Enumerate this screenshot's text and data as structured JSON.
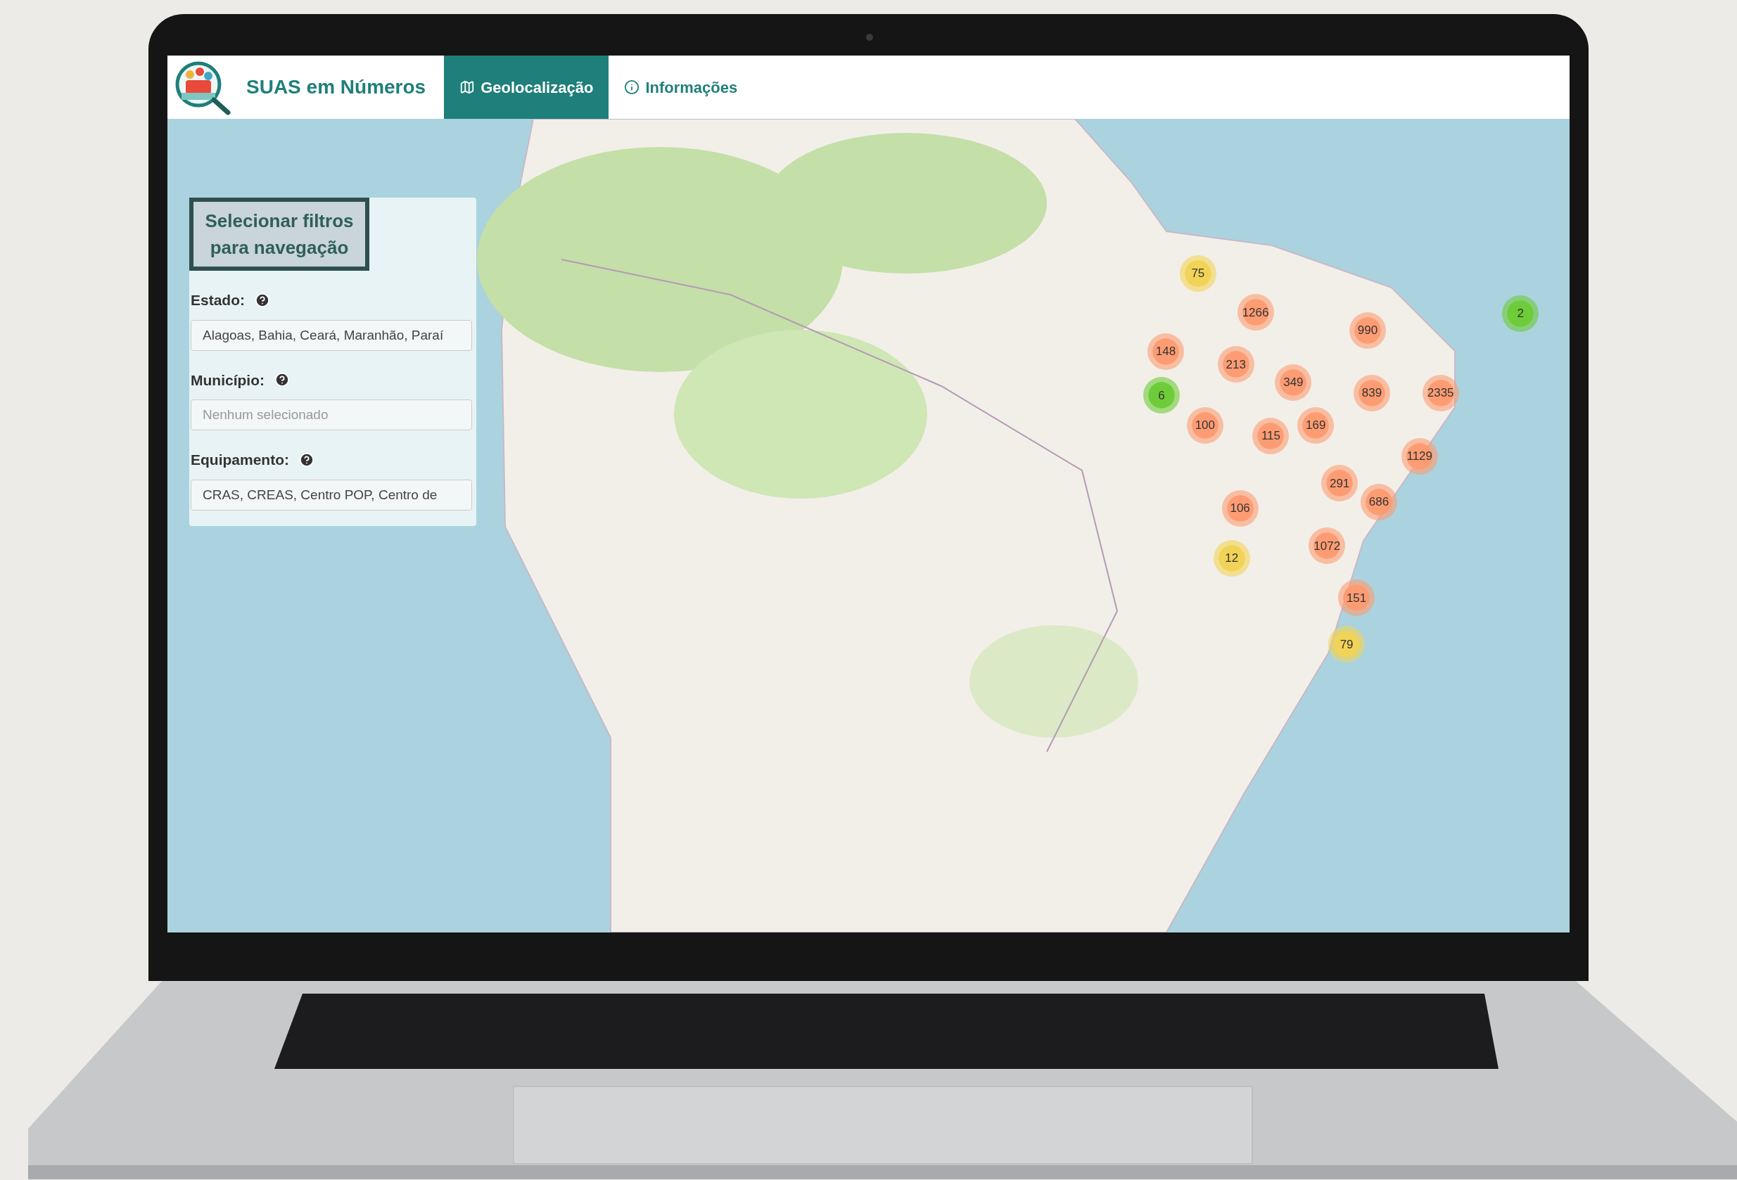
{
  "app": {
    "title": "SUAS em Números"
  },
  "nav": [
    {
      "label": "Geolocalização",
      "kind": "map",
      "selected": true
    },
    {
      "label": "Informações",
      "kind": "info",
      "selected": false
    }
  ],
  "filters": {
    "title": "Selecionar filtros para navegação",
    "fields": [
      {
        "label": "Estado:",
        "value": "Alagoas, Bahia, Ceará, Maranhão, Paraí"
      },
      {
        "label": "Município:",
        "placeholder": "Nenhum selecionado"
      },
      {
        "label": "Equipamento:",
        "value": "CRAS, CREAS, Centro POP, Centro de"
      }
    ]
  },
  "clusters": [
    {
      "count": "75",
      "color": "#f1d357"
    },
    {
      "count": "1266",
      "color": "#fd9c73"
    },
    {
      "count": "990",
      "color": "#fd9c73"
    },
    {
      "count": "2",
      "color": "#6ecc39"
    },
    {
      "count": "148",
      "color": "#fd9c73"
    },
    {
      "count": "213",
      "color": "#fd9c73"
    },
    {
      "count": "349",
      "color": "#fd9c73"
    },
    {
      "count": "6",
      "color": "#6ecc39"
    },
    {
      "count": "839",
      "color": "#fd9c73"
    },
    {
      "count": "2335",
      "color": "#fd9c73"
    },
    {
      "count": "100",
      "color": "#fd9c73"
    },
    {
      "count": "115",
      "color": "#fd9c73"
    },
    {
      "count": "169",
      "color": "#fd9c73"
    },
    {
      "count": "1129",
      "color": "#fd9c73"
    },
    {
      "count": "291",
      "color": "#fd9c73"
    },
    {
      "count": "686",
      "color": "#fd9c73"
    },
    {
      "count": "106",
      "color": "#fd9c73"
    },
    {
      "count": "1072",
      "color": "#fd9c73"
    },
    {
      "count": "12",
      "color": "#f1d357"
    },
    {
      "count": "151",
      "color": "#fd9c73"
    },
    {
      "count": "79",
      "color": "#f1d357"
    }
  ]
}
